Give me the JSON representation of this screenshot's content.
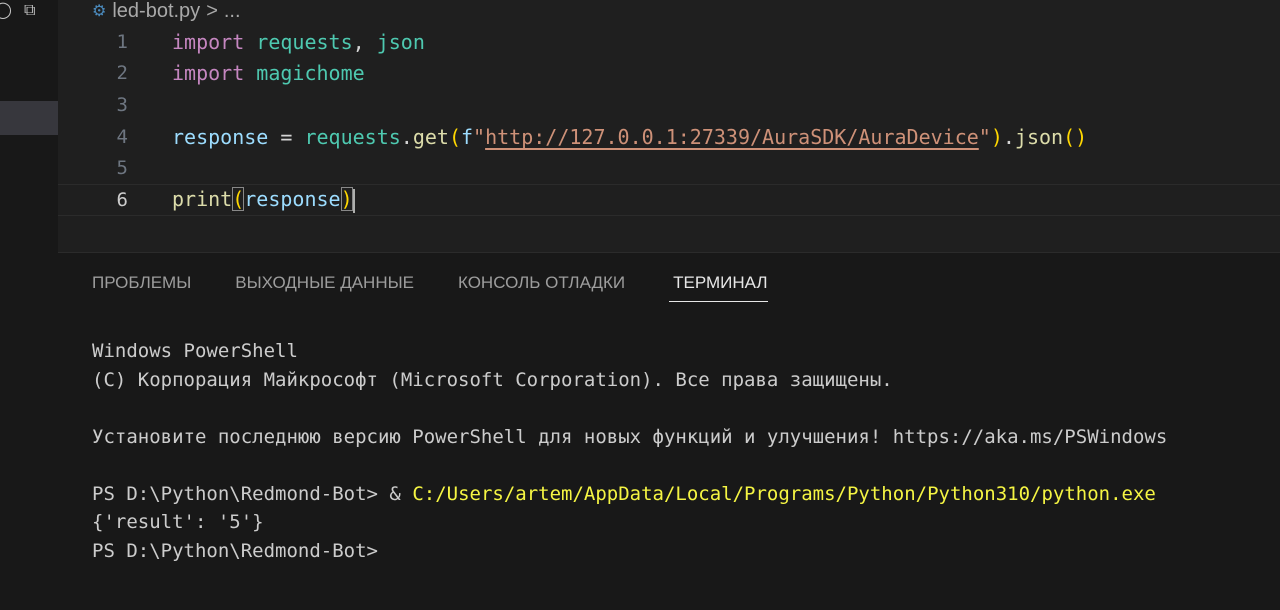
{
  "tab": {
    "filename": "led-bot.py",
    "separator": ">",
    "ellipsis": "..."
  },
  "editor": {
    "lines": [
      {
        "num": "1",
        "tokens": [
          "import",
          " ",
          "requests",
          ", ",
          "json"
        ]
      },
      {
        "num": "2",
        "tokens": [
          "import",
          " ",
          "magichome"
        ]
      },
      {
        "num": "3",
        "tokens": []
      },
      {
        "num": "4",
        "tokens": [
          "response",
          " = ",
          "requests",
          ".",
          "get",
          "(",
          "f",
          "\"",
          "http://127.0.0.1:27339/AuraSDK/AuraDevice",
          "\"",
          ")",
          ".",
          "json",
          "()"
        ]
      },
      {
        "num": "5",
        "tokens": []
      },
      {
        "num": "6",
        "tokens": [
          "print",
          "(",
          "response",
          ")"
        ]
      }
    ]
  },
  "panel": {
    "tabs": [
      {
        "label": "ПРОБЛЕМЫ"
      },
      {
        "label": "ВЫХОДНЫЕ ДАННЫЕ"
      },
      {
        "label": "КОНСОЛЬ ОТЛАДКИ"
      },
      {
        "label": "ТЕРМИНАЛ",
        "active": true
      }
    ]
  },
  "terminal": {
    "line1": "Windows PowerShell",
    "line2": "(C) Корпорация Майкрософт (Microsoft Corporation). Все права защищены.",
    "line3": "Установите последнюю версию PowerShell для новых функций и улучшения! https://aka.ms/PSWindows",
    "prompt1": "PS D:\\Python\\Redmond-Bot> ",
    "cmd_op": "& ",
    "cmd_path": "C:/Users/artem/AppData/Local/Programs/Python/Python310/python.exe",
    "output": "{'result': '5'}",
    "prompt2": "PS D:\\Python\\Redmond-Bot>"
  },
  "colors": {
    "keyword": "#c586c0",
    "module": "#4ec9b0",
    "variable": "#9cdcfe",
    "function": "#dcdcaa",
    "string": "#ce9178",
    "terminal_path": "#f5f543"
  },
  "icons": [
    "restore-icon",
    "split-editor-icon",
    "python-file-icon"
  ]
}
